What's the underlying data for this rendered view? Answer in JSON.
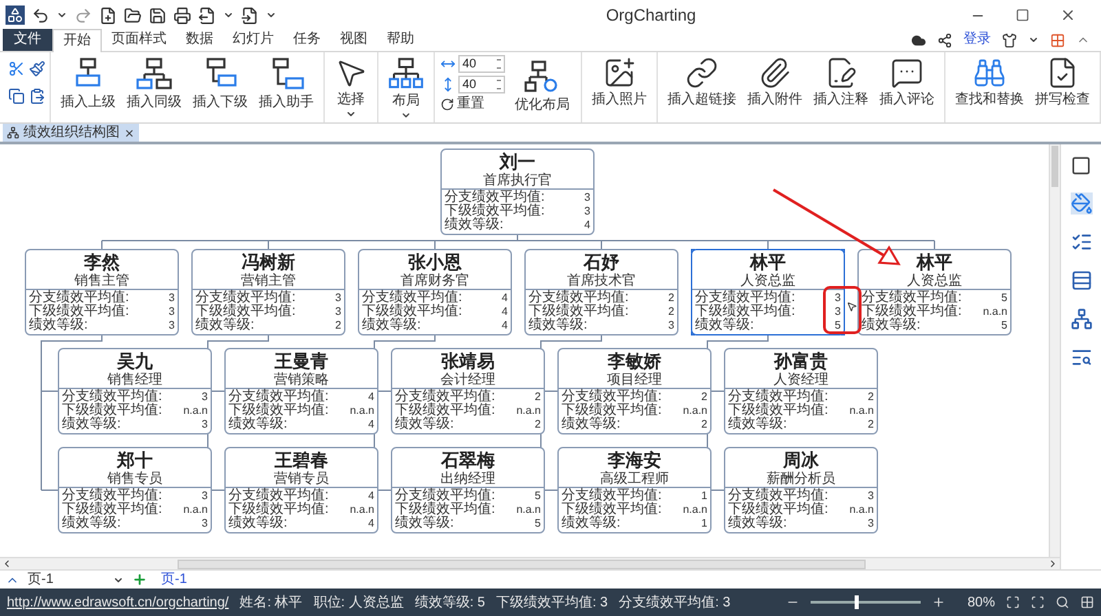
{
  "window": {
    "title": "OrgCharting"
  },
  "menu": {
    "file": "文件",
    "tabs": [
      {
        "label": "开始",
        "selected": true
      },
      {
        "label": "页面样式",
        "selected": false
      },
      {
        "label": "数据",
        "selected": false
      },
      {
        "label": "幻灯片",
        "selected": false
      },
      {
        "label": "任务",
        "selected": false
      },
      {
        "label": "视图",
        "selected": false
      },
      {
        "label": "帮助",
        "selected": false
      }
    ],
    "login": "登录"
  },
  "ribbon": {
    "groups": [
      {
        "kind": "clipboard"
      },
      {
        "kind": "buttons",
        "buttons": [
          {
            "label": "插入上级",
            "dropdown": false
          },
          {
            "label": "插入同级",
            "dropdown": false
          },
          {
            "label": "插入下级",
            "dropdown": false
          },
          {
            "label": "插入助手",
            "dropdown": false
          }
        ]
      },
      {
        "kind": "buttons",
        "buttons": [
          {
            "label": "选择",
            "dropdown": true
          }
        ]
      },
      {
        "kind": "buttons",
        "buttons": [
          {
            "label": "布局",
            "dropdown": true
          }
        ]
      },
      {
        "kind": "spacing",
        "fields": [
          "40",
          "40"
        ],
        "reset": "重置",
        "buttons": [
          {
            "label": "优化布局",
            "dropdown": false
          }
        ]
      },
      {
        "kind": "buttons",
        "buttons": [
          {
            "label": "插入照片",
            "dropdown": false
          }
        ]
      },
      {
        "kind": "buttons",
        "buttons": [
          {
            "label": "插入超链接",
            "dropdown": false
          },
          {
            "label": "插入附件",
            "dropdown": false
          },
          {
            "label": "插入注释",
            "dropdown": false
          },
          {
            "label": "插入评论",
            "dropdown": false
          }
        ]
      },
      {
        "kind": "buttons",
        "buttons": [
          {
            "label": "查找和替换",
            "dropdown": false
          },
          {
            "label": "拼写检查",
            "dropdown": false
          }
        ]
      }
    ]
  },
  "document_tabs": [
    {
      "label": "绩效组织结构图",
      "selected": true
    }
  ],
  "chart": {
    "root": {
      "name": "刘一",
      "title": "首席执行官",
      "selected": false,
      "metrics": [
        {
          "label": "分支绩效平均值:",
          "value": "3"
        },
        {
          "label": "下级绩效平均值:",
          "value": "3"
        },
        {
          "label": "绩效等级:",
          "value": "4"
        }
      ]
    },
    "columns": [
      {
        "node": {
          "name": "李然",
          "title": "销售主管",
          "selected": false,
          "metrics": [
            {
              "label": "分支绩效平均值:",
              "value": "3"
            },
            {
              "label": "下级绩效平均值:",
              "value": "3"
            },
            {
              "label": "绩效等级:",
              "value": "3"
            }
          ]
        },
        "children": [
          {
            "name": "吴九",
            "title": "销售经理",
            "selected": false,
            "metrics": [
              {
                "label": "分支绩效平均值:",
                "value": "3"
              },
              {
                "label": "下级绩效平均值:",
                "value": "n.a.n"
              },
              {
                "label": "绩效等级:",
                "value": "3"
              }
            ]
          },
          {
            "name": "郑十",
            "title": "销售专员",
            "selected": false,
            "metrics": [
              {
                "label": "分支绩效平均值:",
                "value": "3"
              },
              {
                "label": "下级绩效平均值:",
                "value": "n.a.n"
              },
              {
                "label": "绩效等级:",
                "value": "3"
              }
            ]
          }
        ]
      },
      {
        "node": {
          "name": "冯树新",
          "title": "营销主管",
          "selected": false,
          "metrics": [
            {
              "label": "分支绩效平均值:",
              "value": "3"
            },
            {
              "label": "下级绩效平均值:",
              "value": "3"
            },
            {
              "label": "绩效等级:",
              "value": "2"
            }
          ]
        },
        "children": [
          {
            "name": "王曼青",
            "title": "营销策略",
            "selected": false,
            "metrics": [
              {
                "label": "分支绩效平均值:",
                "value": "4"
              },
              {
                "label": "下级绩效平均值:",
                "value": "n.a.n"
              },
              {
                "label": "绩效等级:",
                "value": "4"
              }
            ]
          },
          {
            "name": "王碧春",
            "title": "营销专员",
            "selected": false,
            "metrics": [
              {
                "label": "分支绩效平均值:",
                "value": "4"
              },
              {
                "label": "下级绩效平均值:",
                "value": "n.a.n"
              },
              {
                "label": "绩效等级:",
                "value": "4"
              }
            ]
          }
        ]
      },
      {
        "node": {
          "name": "张小恩",
          "title": "首席财务官",
          "selected": false,
          "metrics": [
            {
              "label": "分支绩效平均值:",
              "value": "4"
            },
            {
              "label": "下级绩效平均值:",
              "value": "4"
            },
            {
              "label": "绩效等级:",
              "value": "4"
            }
          ]
        },
        "children": [
          {
            "name": "张靖易",
            "title": "会计经理",
            "selected": false,
            "metrics": [
              {
                "label": "分支绩效平均值:",
                "value": "2"
              },
              {
                "label": "下级绩效平均值:",
                "value": "n.a.n"
              },
              {
                "label": "绩效等级:",
                "value": "2"
              }
            ]
          },
          {
            "name": "石翠梅",
            "title": "出纳经理",
            "selected": false,
            "metrics": [
              {
                "label": "分支绩效平均值:",
                "value": "5"
              },
              {
                "label": "下级绩效平均值:",
                "value": "n.a.n"
              },
              {
                "label": "绩效等级:",
                "value": "5"
              }
            ]
          }
        ]
      },
      {
        "node": {
          "name": "石妤",
          "title": "首席技术官",
          "selected": false,
          "metrics": [
            {
              "label": "分支绩效平均值:",
              "value": "2"
            },
            {
              "label": "下级绩效平均值:",
              "value": "2"
            },
            {
              "label": "绩效等级:",
              "value": "3"
            }
          ]
        },
        "children": [
          {
            "name": "李敏娇",
            "title": "项目经理",
            "selected": false,
            "metrics": [
              {
                "label": "分支绩效平均值:",
                "value": "2"
              },
              {
                "label": "下级绩效平均值:",
                "value": "n.a.n"
              },
              {
                "label": "绩效等级:",
                "value": "2"
              }
            ]
          },
          {
            "name": "李海安",
            "title": "高级工程师",
            "selected": false,
            "metrics": [
              {
                "label": "分支绩效平均值:",
                "value": "1"
              },
              {
                "label": "下级绩效平均值:",
                "value": "n.a.n"
              },
              {
                "label": "绩效等级:",
                "value": "1"
              }
            ]
          }
        ]
      },
      {
        "node": {
          "name": "林平",
          "title": "人资总监",
          "selected": true,
          "metrics": [
            {
              "label": "分支绩效平均值:",
              "value": "3"
            },
            {
              "label": "下级绩效平均值:",
              "value": "3"
            },
            {
              "label": "绩效等级:",
              "value": "5"
            }
          ]
        },
        "children": [
          {
            "name": "孙富贵",
            "title": "人资经理",
            "selected": false,
            "metrics": [
              {
                "label": "分支绩效平均值:",
                "value": "2"
              },
              {
                "label": "下级绩效平均值:",
                "value": "n.a.n"
              },
              {
                "label": "绩效等级:",
                "value": "2"
              }
            ]
          },
          {
            "name": "周冰",
            "title": "薪酬分析员",
            "selected": false,
            "metrics": [
              {
                "label": "分支绩效平均值:",
                "value": "3"
              },
              {
                "label": "下级绩效平均值:",
                "value": "n.a.n"
              },
              {
                "label": "绩效等级:",
                "value": "3"
              }
            ]
          }
        ]
      },
      {
        "node": {
          "name": "林平",
          "title": "人资总监",
          "selected": false,
          "metrics": [
            {
              "label": "分支绩效平均值:",
              "value": "5"
            },
            {
              "label": "下级绩效平均值:",
              "value": "n.a.n"
            },
            {
              "label": "绩效等级:",
              "value": "5"
            }
          ]
        }
      }
    ]
  },
  "page_bar": {
    "page_select": "页-1",
    "pages": [
      {
        "label": "页-1",
        "selected": true
      }
    ]
  },
  "status_bar": {
    "link": "http://www.edrawsoft.cn/orgcharting/",
    "fields": [
      "姓名: 林平",
      "职位: 人资总监",
      "绩效等级: 5",
      "下级绩效平均值: 3",
      "分支绩效平均值: 3"
    ],
    "zoom": {
      "level": 0.4,
      "reading": "80%"
    }
  }
}
